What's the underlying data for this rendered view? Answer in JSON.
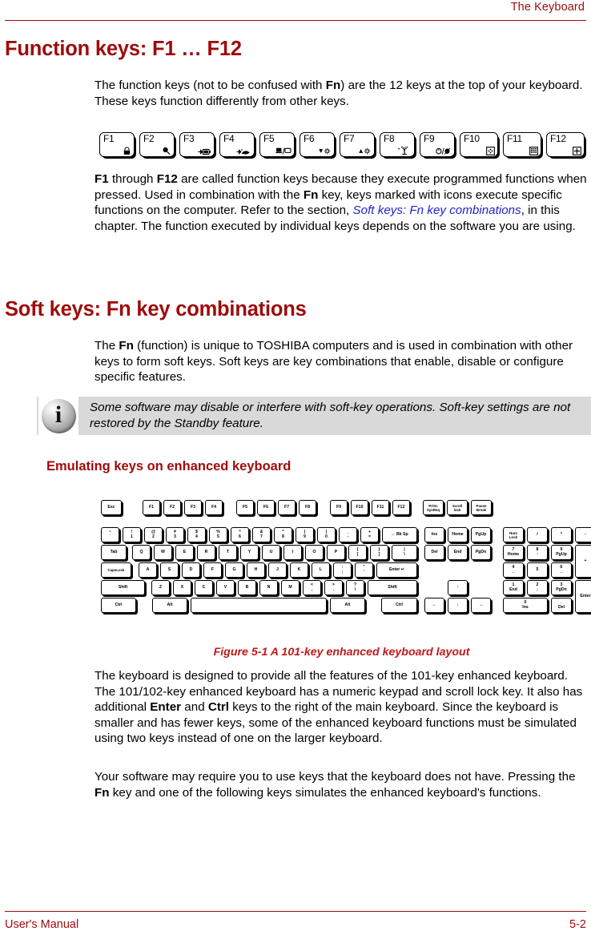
{
  "header": {
    "chapter_title": "The Keyboard"
  },
  "footer": {
    "left": "User's Manual",
    "right": "5-2"
  },
  "sections": {
    "h1_function_keys": "Function keys: F1 … F12",
    "h1_soft_keys": "Soft keys: Fn key combinations",
    "h3_emulating": "Emulating keys on enhanced keyboard"
  },
  "paragraphs": {
    "p1_a": "The function keys (not to be confused with ",
    "p1_fn": "Fn",
    "p1_b": ") are the 12 keys at the top of your keyboard. These keys function differently from other keys.",
    "p2_f1": "F1",
    "p2_a": " through ",
    "p2_f12": "F12",
    "p2_b": " are called function keys because they execute programmed functions when pressed. Used in combination with the ",
    "p2_fn": "Fn",
    "p2_c": " key, keys marked with icons execute specific functions on the computer. Refer to the section, ",
    "p2_link": "Soft keys: Fn key combinations",
    "p2_d": ", in this chapter. The function executed by individual keys depends on the software you are using.",
    "p3_a": "The ",
    "p3_fn": "Fn",
    "p3_b": " (function) is unique to TOSHIBA computers and is used in combination with other keys to form soft keys. Soft keys are key combinations that enable, disable or configure specific features.",
    "p4_a": "The keyboard is designed to provide all the features of the 101-key enhanced keyboard. The 101/102-key enhanced keyboard has a numeric keypad and scroll lock key. It also has additional ",
    "p4_enter": "Enter",
    "p4_b": " and ",
    "p4_ctrl": "Ctrl",
    "p4_c": " keys to the right of the main keyboard. Since the keyboard is smaller and has fewer keys, some of the enhanced keyboard functions must be simulated using two keys instead of one on the larger keyboard.",
    "p5_a": "Your software may require you to use keys that the keyboard does not have. Pressing the ",
    "p5_fn": "Fn",
    "p5_b": " key and one of the following keys simulates the enhanced keyboard's functions."
  },
  "note": {
    "icon": "info-icon",
    "icon_glyph": "i",
    "text": "Some software may disable or interfere with soft-key operations. Soft-key settings are not restored by the Standby feature."
  },
  "figure": {
    "caption": "Figure 5-1 A 101-key enhanced keyboard layout"
  },
  "function_key_strip": [
    {
      "label": "F1",
      "icon": "padlock-icon",
      "glyph": "▮"
    },
    {
      "label": "F2",
      "icon": "magnifier-icon",
      "glyph": "●"
    },
    {
      "label": "F3",
      "icon": "standby-battery-icon",
      "glyph": "⇢▢"
    },
    {
      "label": "F4",
      "icon": "hibernate-icon",
      "glyph": "⇢☁"
    },
    {
      "label": "F5",
      "icon": "display-output-icon",
      "glyph": "⌸/▭"
    },
    {
      "label": "F6",
      "icon": "brightness-down-icon",
      "glyph": "▼☀"
    },
    {
      "label": "F7",
      "icon": "brightness-up-icon",
      "glyph": "▲☀"
    },
    {
      "label": "F8",
      "icon": "wireless-antenna-icon",
      "glyph": "ᴗ"
    },
    {
      "label": "F9",
      "icon": "touchpad-toggle-icon",
      "glyph": "◔/◕"
    },
    {
      "label": "F10",
      "icon": "arrow-keypad-icon",
      "glyph": "⌧"
    },
    {
      "label": "F11",
      "icon": "numeric-keypad-icon",
      "glyph": "⌗"
    },
    {
      "label": "F12",
      "icon": "scroll-lock-icon",
      "glyph": "⊞"
    }
  ],
  "keyboard_layout": {
    "fn_row": [
      "Esc",
      "F1",
      "F2",
      "F3",
      "F4",
      "F5",
      "F6",
      "F7",
      "F8",
      "F9",
      "F10",
      "F11",
      "F12"
    ],
    "fn_row_right": [
      {
        "top": "PrtSc",
        "bottom": "SysReq"
      },
      {
        "top": "Scroll",
        "bottom": "lock"
      },
      {
        "top": "Pause",
        "bottom": "Break"
      }
    ],
    "num_row": [
      {
        "top": "~",
        "bottom": "`"
      },
      {
        "top": "!",
        "bottom": "1"
      },
      {
        "top": "@",
        "bottom": "2"
      },
      {
        "top": "#",
        "bottom": "3"
      },
      {
        "top": "$",
        "bottom": "4"
      },
      {
        "top": "%",
        "bottom": "5"
      },
      {
        "top": "^",
        "bottom": "6"
      },
      {
        "top": "&",
        "bottom": "7"
      },
      {
        "top": "*",
        "bottom": "8"
      },
      {
        "top": "(",
        "bottom": "9"
      },
      {
        "top": ")",
        "bottom": "0"
      },
      {
        "top": "_",
        "bottom": "-"
      },
      {
        "top": "+",
        "bottom": "="
      }
    ],
    "backspace": "←  Bk Sp",
    "tab_row": [
      "Tab",
      "Q",
      "W",
      "E",
      "R",
      "T",
      "Y",
      "U",
      "I",
      "O",
      "P"
    ],
    "tab_row_punct": [
      {
        "top": "{",
        "bottom": "["
      },
      {
        "top": "}",
        "bottom": "]"
      },
      {
        "top": "|",
        "bottom": "\\"
      }
    ],
    "caps_row": [
      "CapsLock",
      "A",
      "S",
      "D",
      "F",
      "G",
      "H",
      "J",
      "K",
      "L"
    ],
    "caps_row_punct": [
      {
        "top": ":",
        "bottom": ";"
      },
      {
        "top": "\"",
        "bottom": "'"
      }
    ],
    "enter": "Enter ↵",
    "shift_row_left": "Shift",
    "shift_row": [
      "Z",
      "X",
      "C",
      "V",
      "B",
      "N",
      "M"
    ],
    "shift_row_punct": [
      {
        "top": "<",
        "bottom": ","
      },
      {
        "top": ">",
        "bottom": "."
      },
      {
        "top": "?",
        "bottom": "/"
      }
    ],
    "shift_row_right": "Shift",
    "bottom_row": [
      "Ctrl",
      "Alt",
      "",
      "Alt",
      "Ctrl"
    ],
    "nav_cluster": [
      {
        "top": "Ins",
        "bottom": ""
      },
      {
        "top": "Home",
        "bottom": ""
      },
      {
        "top": "PgUp",
        "bottom": ""
      },
      {
        "top": "Del",
        "bottom": ""
      },
      {
        "top": "End",
        "bottom": ""
      },
      {
        "top": "PgDn",
        "bottom": ""
      }
    ],
    "arrows": {
      "up": "↑",
      "left": "←",
      "down": "↓",
      "right": "→"
    },
    "keypad": [
      {
        "top": "Num",
        "bottom": "Lock"
      },
      {
        "top": "/",
        "bottom": ""
      },
      {
        "top": "*",
        "bottom": ""
      },
      {
        "top": "-",
        "bottom": ""
      },
      {
        "top": "7",
        "bottom": "Home"
      },
      {
        "top": "8",
        "bottom": "↑"
      },
      {
        "top": "9",
        "bottom": "PgUp"
      },
      {
        "top": "+",
        "bottom": ""
      },
      {
        "top": "4",
        "bottom": "←"
      },
      {
        "top": "5",
        "bottom": ""
      },
      {
        "top": "6",
        "bottom": "→"
      },
      {
        "top": "1",
        "bottom": "End"
      },
      {
        "top": "2",
        "bottom": "↓"
      },
      {
        "top": "3",
        "bottom": "PgDn"
      },
      {
        "top": "Enter",
        "bottom": ""
      },
      {
        "top": "0",
        "bottom": "Ins"
      },
      {
        "top": ".",
        "bottom": "Del"
      }
    ]
  },
  "colors": {
    "accent_red": "#9e0b0b",
    "caption_red": "#c01a1a",
    "link_blue": "#2222cc",
    "note_bg": "#d9d9d9"
  }
}
